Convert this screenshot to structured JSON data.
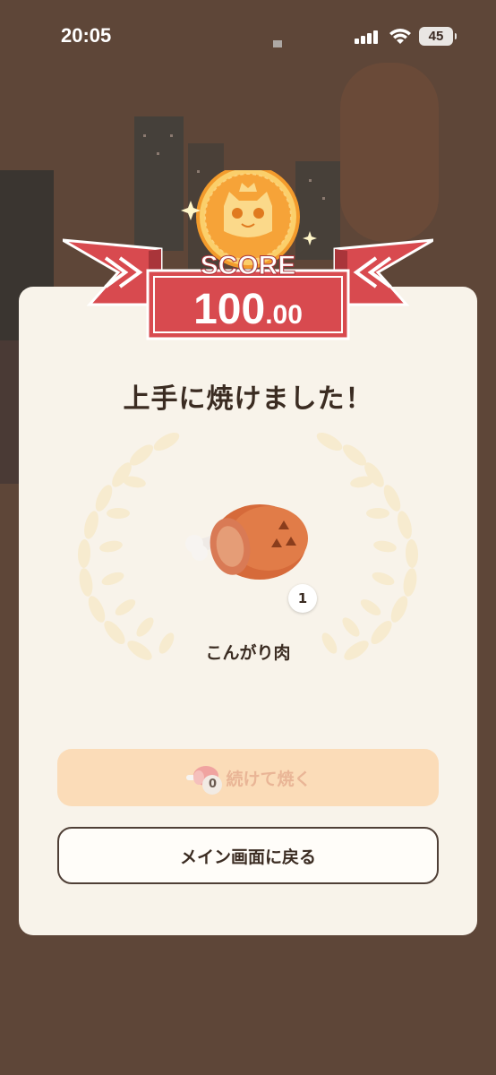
{
  "status_bar": {
    "time": "20:05",
    "battery": "45"
  },
  "score": {
    "label": "SCORE",
    "integer": "100",
    "decimal": ".00"
  },
  "result": {
    "title": "上手に焼けました！",
    "item_name": "こんがり肉",
    "item_count": "1"
  },
  "buttons": {
    "continue_label": "続けて焼く",
    "continue_stock": "0",
    "main_label": "メイン画面に戻る"
  },
  "colors": {
    "ribbon": "#d84a4f",
    "medal": "#f6a338",
    "card_bg": "#f8f3ea",
    "continue_bg": "#fbdcb8"
  }
}
